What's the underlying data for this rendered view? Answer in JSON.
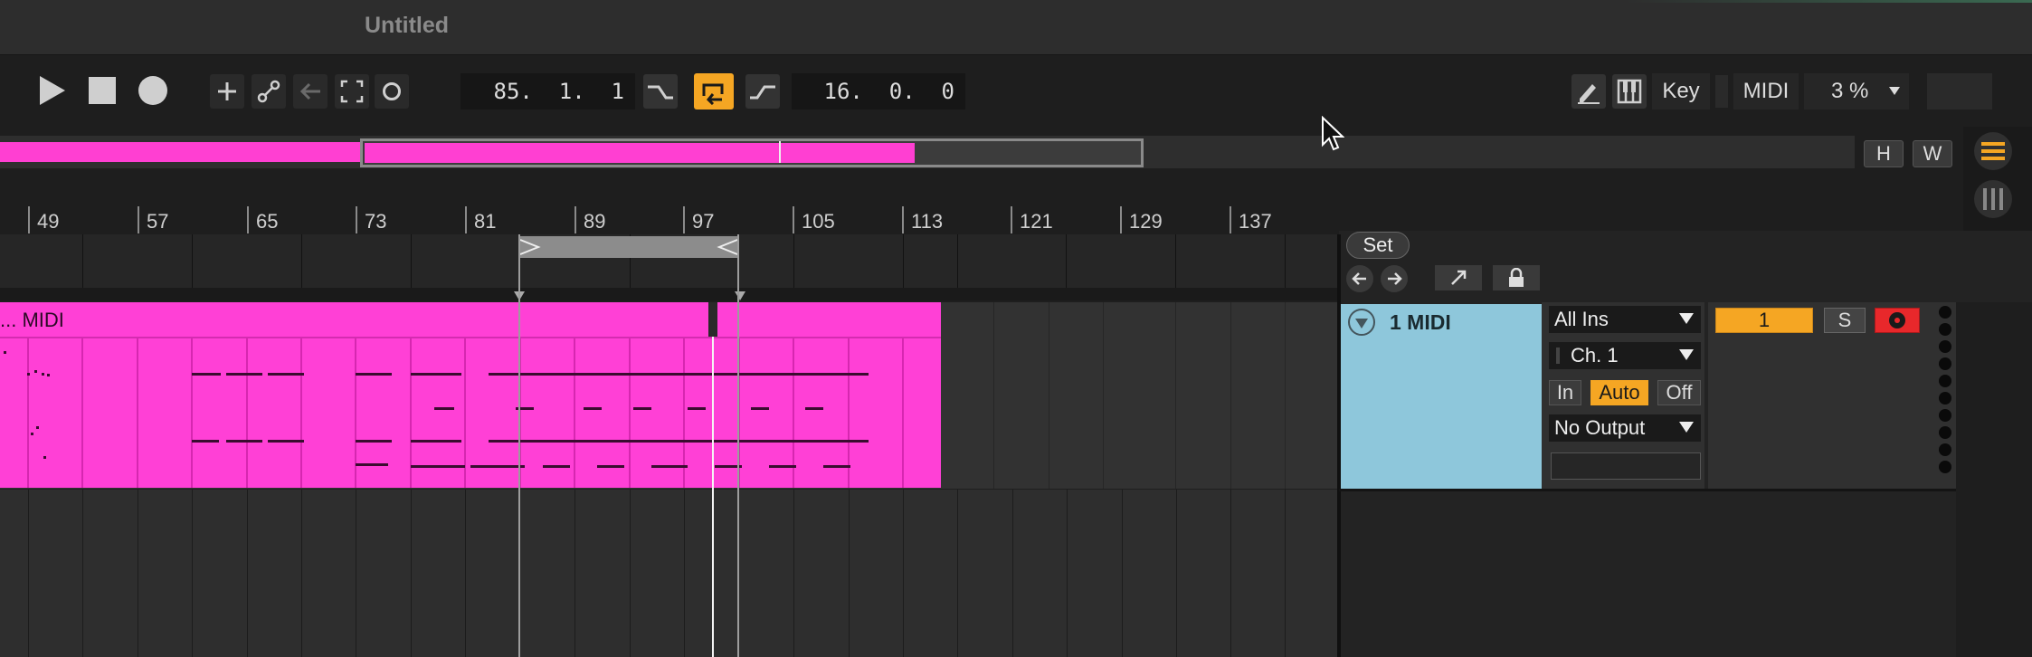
{
  "window": {
    "title": "Untitled"
  },
  "transport": {
    "position": "85.  1.  1",
    "loop_length": "16.  0.  0"
  },
  "toolbar_right": {
    "key_label": "Key",
    "midi_label": "MIDI",
    "zoom_value": "3 %"
  },
  "overview_buttons": {
    "h": "H",
    "w": "W"
  },
  "ruler": {
    "labels": [
      "49",
      "57",
      "65",
      "73",
      "81",
      "89",
      "97",
      "105",
      "113",
      "121",
      "129",
      "137"
    ]
  },
  "set_button": "Set",
  "clip": {
    "name": "... MIDI"
  },
  "track": {
    "name": "1 MIDI",
    "input_type": "All Ins",
    "input_channel": "Ch. 1",
    "monitor": [
      "In",
      "Auto",
      "Off"
    ],
    "output": "No Output",
    "number": "1",
    "solo": "S"
  },
  "colors": {
    "clip": "#ff40d6",
    "track_header": "#8ec7db",
    "accent": "#f5a623",
    "arm": "#e8282b"
  }
}
